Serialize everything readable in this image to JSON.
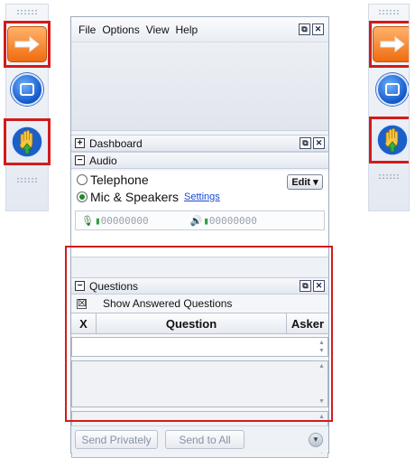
{
  "menu": {
    "items": [
      "File",
      "Options",
      "View",
      "Help"
    ]
  },
  "window_controls": {
    "restore": "⧉",
    "close": "✕"
  },
  "dashboard": {
    "title": "Dashboard",
    "toggle": "+"
  },
  "audio": {
    "title": "Audio",
    "toggle": "−",
    "options": [
      {
        "label": "Telephone",
        "selected": false
      },
      {
        "label": "Mic & Speakers",
        "selected": true
      }
    ],
    "settings_link": "Settings",
    "edit_button": "Edit ▾",
    "mic_level": "00000000",
    "speaker_level": "00000000"
  },
  "questions": {
    "title": "Questions",
    "toggle": "−",
    "show_answered_label": "Show Answered Questions",
    "show_answered_checked": true,
    "columns": {
      "x": "X",
      "question": "Question",
      "asker": "Asker"
    }
  },
  "footer": {
    "send_privately": "Send Privately",
    "send_to_all": "Send to All"
  },
  "colors": {
    "highlight": "#d21b1b",
    "accent_orange": "#ef6c0f",
    "accent_blue": "#1158c9"
  },
  "toolbar_icons": [
    "arrow-right-icon",
    "stop-square-icon",
    "raise-hand-icon"
  ]
}
